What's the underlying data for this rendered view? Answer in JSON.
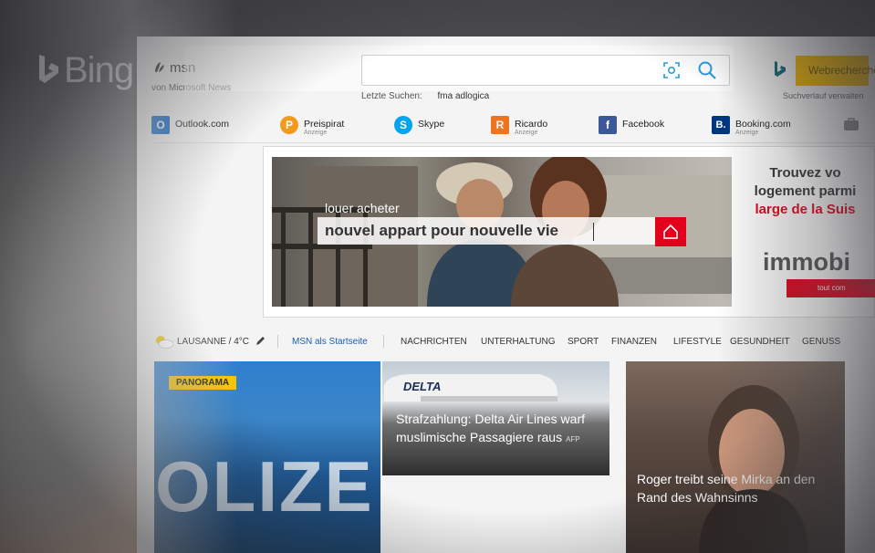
{
  "bing": {
    "logo_text": "Bing"
  },
  "msn": {
    "brand": "msn",
    "subtitle": "von Microsoft News"
  },
  "search": {
    "value": "",
    "button_label": "Webrecherche",
    "recent_label": "Letzte Suchen:",
    "recent_item": "fma adlogica",
    "history_label": "Suchverlauf verwalten"
  },
  "quicklinks": [
    {
      "label": "Outlook.com",
      "sub": "",
      "icon": "outlook-icon",
      "color": "#0a64c8",
      "glyph": "O"
    },
    {
      "label": "Preispirat",
      "sub": "Anzeige",
      "icon": "preispirat-icon",
      "color": "#f39a1e",
      "glyph": "P"
    },
    {
      "label": "Skype",
      "sub": "",
      "icon": "skype-icon",
      "color": "#00a4ef",
      "glyph": "S"
    },
    {
      "label": "Ricardo",
      "sub": "Anzeige",
      "icon": "ricardo-icon",
      "color": "#f0731e",
      "glyph": "R"
    },
    {
      "label": "Facebook",
      "sub": "",
      "icon": "facebook-icon",
      "color": "#3b5998",
      "glyph": "f"
    },
    {
      "label": "Booking.com",
      "sub": "Anzeige",
      "icon": "booking-icon",
      "color": "#003580",
      "glyph": "B."
    }
  ],
  "ad": {
    "caption": "louer acheter",
    "headline": "nouvel appart pour nouvelle vie",
    "text_line1": "Trouvez vo",
    "text_line2": "logement parmi",
    "text_line3": "large de la Suis",
    "brand": "immobi",
    "cta": "tout com",
    "accent": "#e3001b"
  },
  "nav": {
    "weather": "LAUSANNE / 4°C",
    "startpage": "MSN als Startseite",
    "items": [
      "NACHRICHTEN",
      "UNTERHALTUNG",
      "SPORT",
      "FINANZEN",
      "LIFESTYLE",
      "GESUNDHEIT",
      "GENUSS"
    ]
  },
  "tiles": [
    {
      "badge": "PANORAMA",
      "image_text": "OLIZE"
    },
    {
      "airline": "DELTA",
      "headline": "Strafzahlung: Delta Air Lines warf muslimische Passagiere raus",
      "source": "AFP"
    },
    {
      "headline": "Roger treibt seine Mirka an den Rand des Wahnsinns"
    }
  ]
}
